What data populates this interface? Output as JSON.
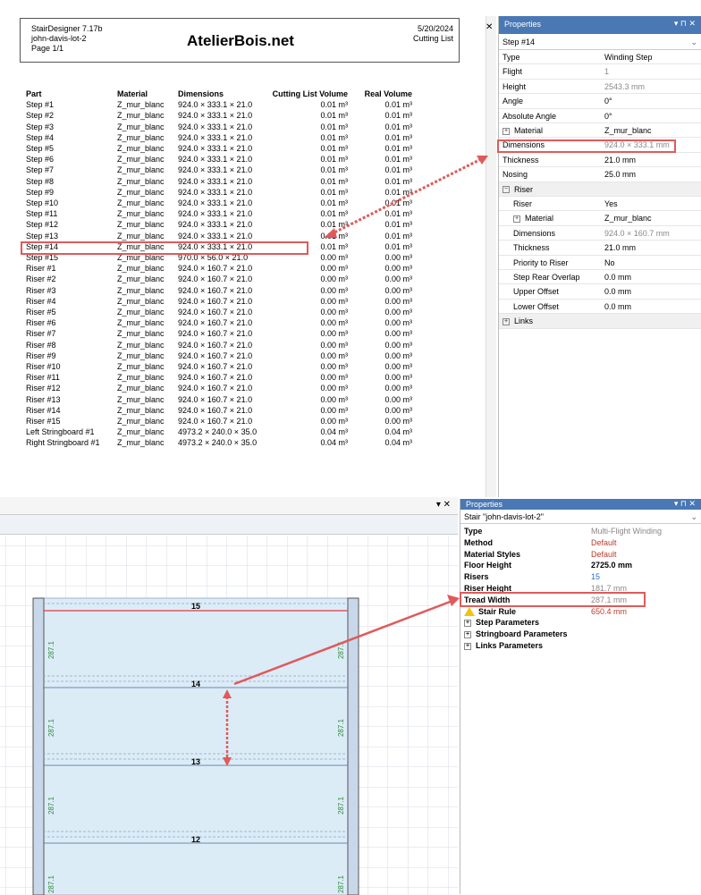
{
  "report": {
    "app": "StairDesigner 7.17b",
    "project": "john-davis-lot-2",
    "page": "Page 1/1",
    "brand": "AtelierBois.net",
    "date": "5/20/2024",
    "doc_type": "Cutting List",
    "columns": [
      "Part",
      "Material",
      "Dimensions",
      "Cutting List Volume",
      "Real Volume"
    ],
    "rows": [
      [
        "Step #1",
        "Z_mur_blanc",
        "924.0 × 333.1 × 21.0",
        "0.01 m³",
        "0.01 m³"
      ],
      [
        "Step #2",
        "Z_mur_blanc",
        "924.0 × 333.1 × 21.0",
        "0.01 m³",
        "0.01 m³"
      ],
      [
        "Step #3",
        "Z_mur_blanc",
        "924.0 × 333.1 × 21.0",
        "0.01 m³",
        "0.01 m³"
      ],
      [
        "Step #4",
        "Z_mur_blanc",
        "924.0 × 333.1 × 21.0",
        "0.01 m³",
        "0.01 m³"
      ],
      [
        "Step #5",
        "Z_mur_blanc",
        "924.0 × 333.1 × 21.0",
        "0.01 m³",
        "0.01 m³"
      ],
      [
        "Step #6",
        "Z_mur_blanc",
        "924.0 × 333.1 × 21.0",
        "0.01 m³",
        "0.01 m³"
      ],
      [
        "Step #7",
        "Z_mur_blanc",
        "924.0 × 333.1 × 21.0",
        "0.01 m³",
        "0.01 m³"
      ],
      [
        "Step #8",
        "Z_mur_blanc",
        "924.0 × 333.1 × 21.0",
        "0.01 m³",
        "0.01 m³"
      ],
      [
        "Step #9",
        "Z_mur_blanc",
        "924.0 × 333.1 × 21.0",
        "0.01 m³",
        "0.01 m³"
      ],
      [
        "Step #10",
        "Z_mur_blanc",
        "924.0 × 333.1 × 21.0",
        "0.01 m³",
        "0.01 m³"
      ],
      [
        "Step #11",
        "Z_mur_blanc",
        "924.0 × 333.1 × 21.0",
        "0.01 m³",
        "0.01 m³"
      ],
      [
        "Step #12",
        "Z_mur_blanc",
        "924.0 × 333.1 × 21.0",
        "0.01 m³",
        "0.01 m³"
      ],
      [
        "Step #13",
        "Z_mur_blanc",
        "924.0 × 333.1 × 21.0",
        "0.01 m³",
        "0.01 m³"
      ],
      [
        "Step #14",
        "Z_mur_blanc",
        "924.0 × 333.1 × 21.0",
        "0.01 m³",
        "0.01 m³"
      ],
      [
        "Step #15",
        "Z_mur_blanc",
        "970.0 × 56.0 × 21.0",
        "0.00 m³",
        "0.00 m³"
      ],
      [
        "Riser #1",
        "Z_mur_blanc",
        "924.0 × 160.7 × 21.0",
        "0.00 m³",
        "0.00 m³"
      ],
      [
        "Riser #2",
        "Z_mur_blanc",
        "924.0 × 160.7 × 21.0",
        "0.00 m³",
        "0.00 m³"
      ],
      [
        "Riser #3",
        "Z_mur_blanc",
        "924.0 × 160.7 × 21.0",
        "0.00 m³",
        "0.00 m³"
      ],
      [
        "Riser #4",
        "Z_mur_blanc",
        "924.0 × 160.7 × 21.0",
        "0.00 m³",
        "0.00 m³"
      ],
      [
        "Riser #5",
        "Z_mur_blanc",
        "924.0 × 160.7 × 21.0",
        "0.00 m³",
        "0.00 m³"
      ],
      [
        "Riser #6",
        "Z_mur_blanc",
        "924.0 × 160.7 × 21.0",
        "0.00 m³",
        "0.00 m³"
      ],
      [
        "Riser #7",
        "Z_mur_blanc",
        "924.0 × 160.7 × 21.0",
        "0.00 m³",
        "0.00 m³"
      ],
      [
        "Riser #8",
        "Z_mur_blanc",
        "924.0 × 160.7 × 21.0",
        "0.00 m³",
        "0.00 m³"
      ],
      [
        "Riser #9",
        "Z_mur_blanc",
        "924.0 × 160.7 × 21.0",
        "0.00 m³",
        "0.00 m³"
      ],
      [
        "Riser #10",
        "Z_mur_blanc",
        "924.0 × 160.7 × 21.0",
        "0.00 m³",
        "0.00 m³"
      ],
      [
        "Riser #11",
        "Z_mur_blanc",
        "924.0 × 160.7 × 21.0",
        "0.00 m³",
        "0.00 m³"
      ],
      [
        "Riser #12",
        "Z_mur_blanc",
        "924.0 × 160.7 × 21.0",
        "0.00 m³",
        "0.00 m³"
      ],
      [
        "Riser #13",
        "Z_mur_blanc",
        "924.0 × 160.7 × 21.0",
        "0.00 m³",
        "0.00 m³"
      ],
      [
        "Riser #14",
        "Z_mur_blanc",
        "924.0 × 160.7 × 21.0",
        "0.00 m³",
        "0.00 m³"
      ],
      [
        "Riser #15",
        "Z_mur_blanc",
        "924.0 × 160.7 × 21.0",
        "0.00 m³",
        "0.00 m³"
      ],
      [
        "Left Stringboard #1",
        "Z_mur_blanc",
        "4973.2 × 240.0 × 35.0",
        "0.04 m³",
        "0.04 m³"
      ],
      [
        "Right Stringboard #1",
        "Z_mur_blanc",
        "4973.2 × 240.0 × 35.0",
        "0.04 m³",
        "0.04 m³"
      ]
    ],
    "highlighted_row": 13
  },
  "props_top": {
    "title": "Properties",
    "controls": "▾ ⊓ ✕",
    "selected": "Step #14",
    "rows": [
      {
        "k": "Type",
        "v": "Winding Step",
        "gray": false
      },
      {
        "k": "Flight",
        "v": "1",
        "gray": true
      },
      {
        "k": "Height",
        "v": "2543.3 mm",
        "gray": true
      },
      {
        "k": "Angle",
        "v": "0°",
        "gray": false
      },
      {
        "k": "Absolute Angle",
        "v": "0°",
        "gray": false
      },
      {
        "k": "Material",
        "v": "Z_mur_blanc",
        "gray": false,
        "expander": true
      },
      {
        "k": "Dimensions",
        "v": "924.0 × 333.1 mm",
        "gray": true
      },
      {
        "k": "Thickness",
        "v": "21.0 mm",
        "gray": false
      },
      {
        "k": "Nosing",
        "v": "25.0 mm",
        "gray": false
      },
      {
        "k": "Riser",
        "v": "",
        "gray": false,
        "category": true
      },
      {
        "k": "Riser",
        "v": "Yes",
        "gray": false,
        "indent": true
      },
      {
        "k": "Material",
        "v": "Z_mur_blanc",
        "gray": false,
        "indent": true,
        "expander": true
      },
      {
        "k": "Dimensions",
        "v": "924.0 × 160.7 mm",
        "gray": true,
        "indent": true
      },
      {
        "k": "Thickness",
        "v": "21.0 mm",
        "gray": false,
        "indent": true
      },
      {
        "k": "Priority to Riser",
        "v": "No",
        "gray": false,
        "indent": true
      },
      {
        "k": "Step Rear Overlap",
        "v": "0.0 mm",
        "gray": false,
        "indent": true
      },
      {
        "k": "Upper Offset",
        "v": "0.0 mm",
        "gray": false,
        "indent": true
      },
      {
        "k": "Lower Offset",
        "v": "0.0 mm",
        "gray": false,
        "indent": true
      },
      {
        "k": "Links",
        "v": "",
        "gray": false,
        "category": true
      }
    ]
  },
  "props_bottom": {
    "title": "Properties",
    "controls": "▾ ⊓ ✕",
    "selected": "Stair \"john-davis-lot-2\"",
    "rows": [
      {
        "k": "Type",
        "v": "Multi-Flight Winding",
        "color": "gray"
      },
      {
        "k": "Method",
        "v": "Default",
        "color": "red"
      },
      {
        "k": "Material Styles",
        "v": "Default",
        "color": "red"
      },
      {
        "k": "Floor Height",
        "v": "2725.0 mm",
        "color": "bold"
      },
      {
        "k": "Risers",
        "v": "15",
        "color": "blue"
      },
      {
        "k": "Riser Height",
        "v": "181.7 mm",
        "color": "gray"
      },
      {
        "k": "Tread Width",
        "v": "287.1 mm",
        "color": "gray"
      },
      {
        "k": "Stair Rule",
        "v": "650.4 mm",
        "color": "red",
        "warn": true
      },
      {
        "k": "Step Parameters",
        "v": "",
        "expander": true
      },
      {
        "k": "Stringboard Parameters",
        "v": "",
        "expander": true
      },
      {
        "k": "Links Parameters",
        "v": "",
        "expander": true
      }
    ]
  },
  "drawing": {
    "close_controls": "▾ ✕",
    "step_labels": [
      "15",
      "14",
      "13",
      "12"
    ],
    "tread_label": "287.1"
  },
  "colors": {
    "accent_red": "#e05a5a",
    "title_blue": "#4a78b5",
    "stair_fill": "#dcecf7",
    "stringboard": "#c8d8ea"
  }
}
